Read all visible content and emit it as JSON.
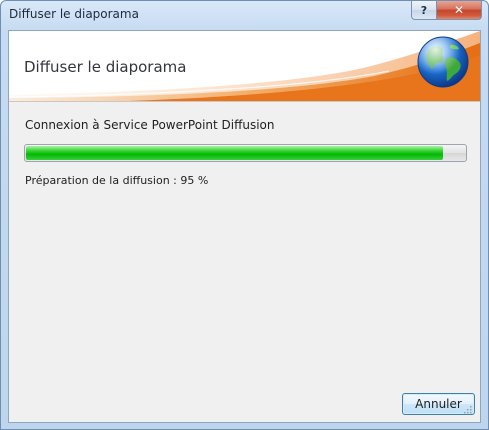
{
  "window": {
    "title": "Diffuser le diaporama",
    "help_button": "?",
    "close_button": "✕"
  },
  "banner": {
    "title": "Diffuser le diaporama",
    "icon": "globe-icon",
    "accent_color": "#e9751f"
  },
  "progress": {
    "status": "Connexion à Service PowerPoint Diffusion",
    "percent": 95,
    "detail": "Préparation de la diffusion : 95 %",
    "bar_color": "#14c314"
  },
  "actions": {
    "cancel_label": "Annuler"
  }
}
